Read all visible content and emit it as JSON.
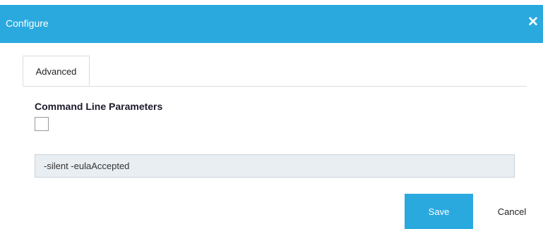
{
  "dialog": {
    "title": "Configure",
    "close_glyph": "✕",
    "close_icon": "close-icon"
  },
  "tabs": [
    {
      "label": "Advanced",
      "active": true
    }
  ],
  "section": {
    "label": "Command Line Parameters",
    "checkbox_checked": false,
    "parameters_value": "-silent -eulaAccepted"
  },
  "footer": {
    "save_label": "Save",
    "cancel_label": "Cancel"
  },
  "colors": {
    "accent": "#2aa9df",
    "input_background": "#e9eef2"
  }
}
